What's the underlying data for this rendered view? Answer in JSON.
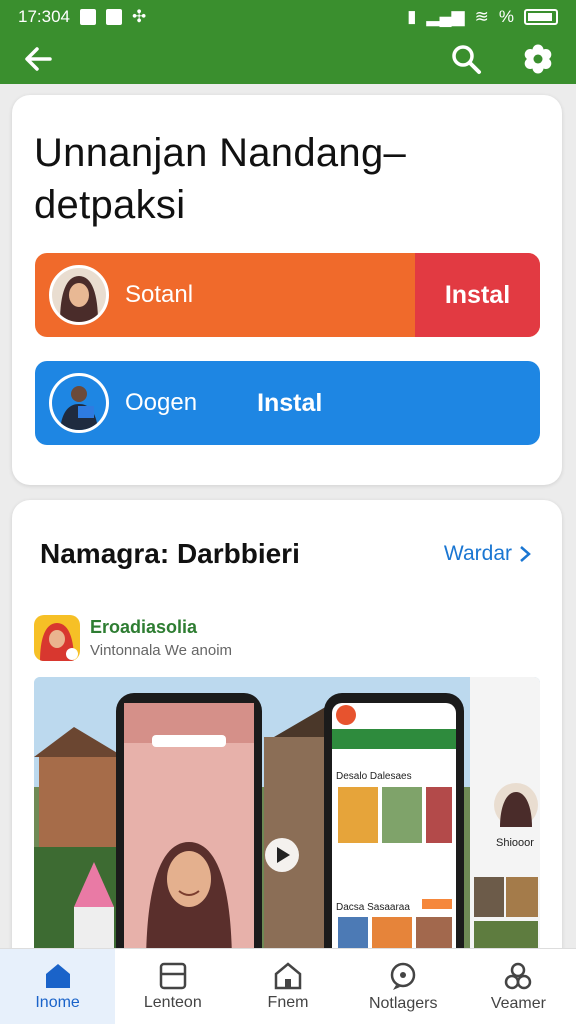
{
  "status_bar": {
    "time": "17:304",
    "right_text": "%"
  },
  "card_header": {
    "title": "Unnanjan Nandang–\ndetpaksi"
  },
  "banners": [
    {
      "name": "Sotanl",
      "install_label": "Instal"
    },
    {
      "name": "Oogen",
      "install_label": "Instal"
    }
  ],
  "section": {
    "title": "Namagra: Darbbieri",
    "more_label": "Wardar",
    "developer_name": "Eroadiasolia",
    "developer_sub": "Vintonnala We anoim"
  },
  "screenshot": {
    "phone2_header": "Desalo Dalesaes",
    "phone2_section": "Dacsa Sasaaraa",
    "side_caption": "Shiooor"
  },
  "nav": [
    {
      "label": "Inome",
      "icon": "home-icon"
    },
    {
      "label": "Lenteon",
      "icon": "card-icon"
    },
    {
      "label": "Fnem",
      "icon": "house-outline-icon"
    },
    {
      "label": "Notlagers",
      "icon": "chat-bubble-icon"
    },
    {
      "label": "Veamer",
      "icon": "people-icon"
    }
  ],
  "colors": {
    "appbar": "#3a8f2e",
    "orange": "#f06a2b",
    "red": "#e23a42",
    "blue": "#1e86e3",
    "accent": "#1a76d2"
  }
}
